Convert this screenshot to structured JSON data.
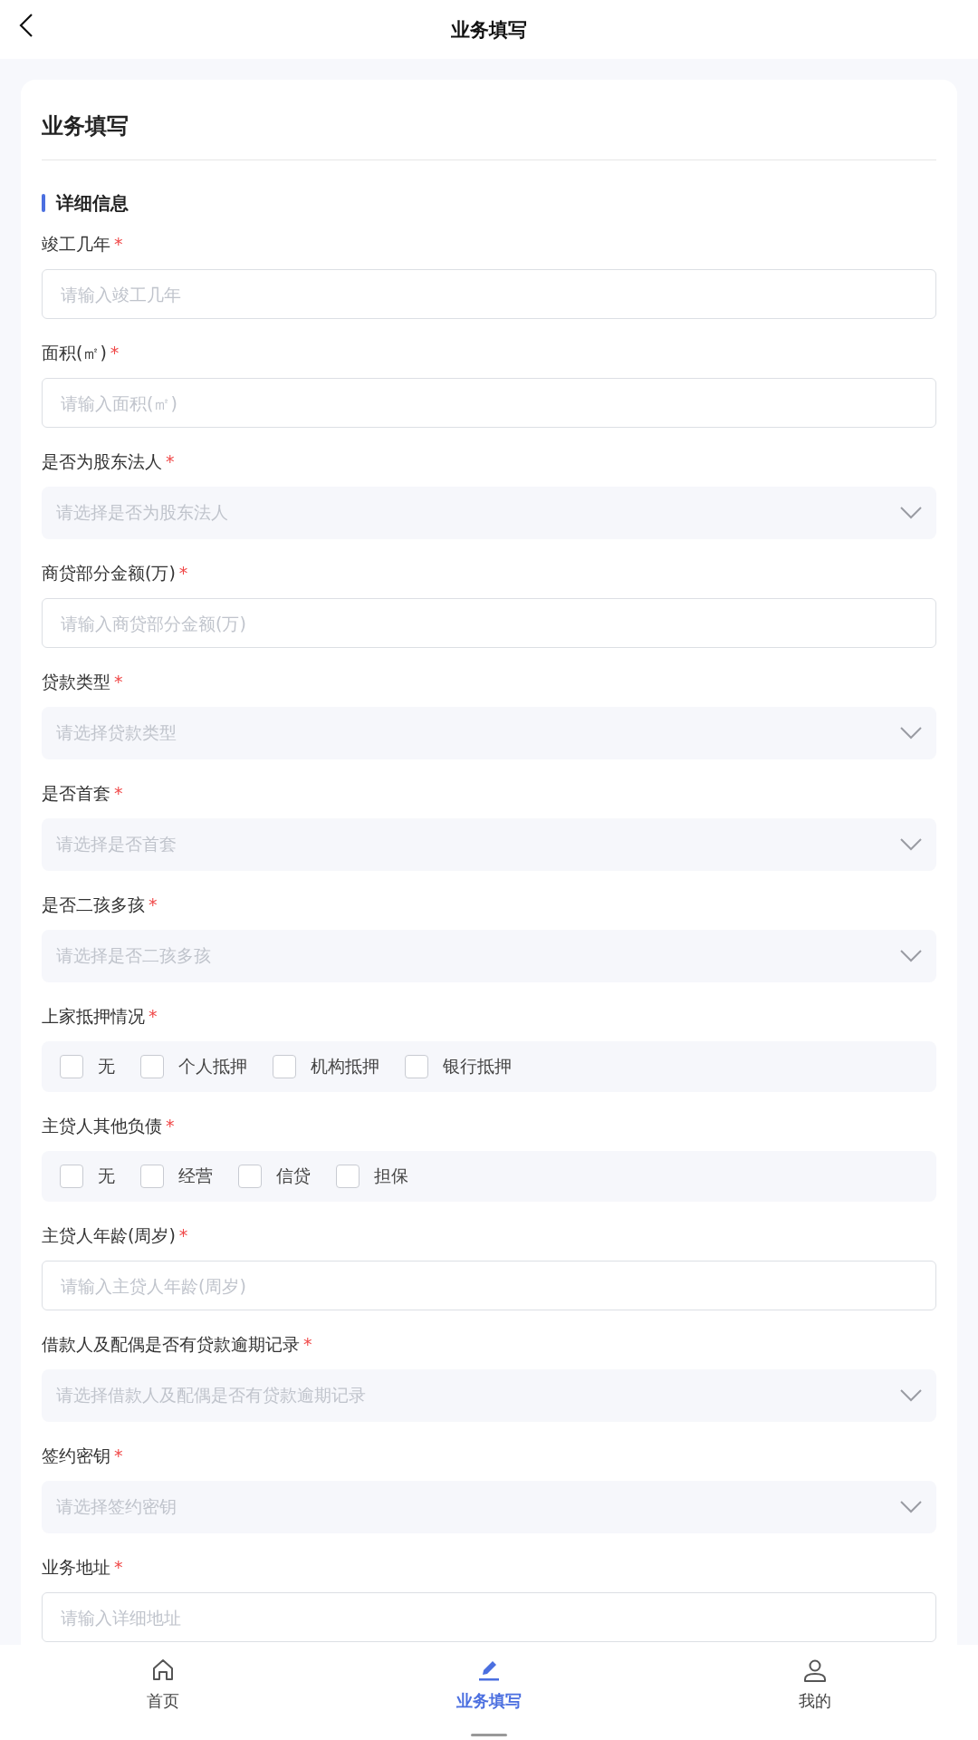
{
  "header": {
    "title": "业务填写"
  },
  "card": {
    "title": "业务填写",
    "section": "详细信息",
    "fields": [
      {
        "kind": "input",
        "label": "竣工几年",
        "required_mark": "*",
        "placeholder": "请输入竣工几年"
      },
      {
        "kind": "input",
        "label": "面积(㎡)",
        "required_mark": "*",
        "placeholder": "请输入面积(㎡)"
      },
      {
        "kind": "select",
        "label": "是否为股东法人",
        "required_mark": "*",
        "placeholder": "请选择是否为股东法人"
      },
      {
        "kind": "input",
        "label": "商贷部分金额(万)",
        "required_mark": "*",
        "placeholder": "请输入商贷部分金额(万)"
      },
      {
        "kind": "select",
        "label": "贷款类型",
        "required_mark": "*",
        "placeholder": "请选择贷款类型"
      },
      {
        "kind": "select",
        "label": "是否首套",
        "required_mark": "*",
        "placeholder": "请选择是否首套"
      },
      {
        "kind": "select",
        "label": "是否二孩多孩",
        "required_mark": "*",
        "placeholder": "请选择是否二孩多孩"
      },
      {
        "kind": "checkbox",
        "label": "上家抵押情况",
        "required_mark": "*",
        "options": [
          {
            "label": "无",
            "checked": false
          },
          {
            "label": "个人抵押",
            "checked": false
          },
          {
            "label": "机构抵押",
            "checked": false
          },
          {
            "label": "银行抵押",
            "checked": false
          }
        ]
      },
      {
        "kind": "checkbox",
        "label": "主贷人其他负债",
        "required_mark": "*",
        "options": [
          {
            "label": "无",
            "checked": false
          },
          {
            "label": "经营",
            "checked": false
          },
          {
            "label": "信贷",
            "checked": false
          },
          {
            "label": "担保",
            "checked": false
          }
        ]
      },
      {
        "kind": "input",
        "label": "主贷人年龄(周岁)",
        "required_mark": "*",
        "placeholder": "请输入主贷人年龄(周岁)"
      },
      {
        "kind": "select",
        "label": "借款人及配偶是否有贷款逾期记录",
        "required_mark": "*",
        "placeholder": "请选择借款人及配偶是否有贷款逾期记录"
      },
      {
        "kind": "select",
        "label": "签约密钥",
        "required_mark": "*",
        "placeholder": "请选择签约密钥"
      },
      {
        "kind": "input",
        "label": "业务地址",
        "required_mark": "*",
        "placeholder": "请输入详细地址"
      }
    ]
  },
  "tabbar": [
    {
      "kind": "home",
      "label": "首页",
      "selected": false
    },
    {
      "kind": "edit",
      "label": "业务填写",
      "selected": true
    },
    {
      "kind": "user",
      "label": "我的",
      "selected": false
    }
  ]
}
